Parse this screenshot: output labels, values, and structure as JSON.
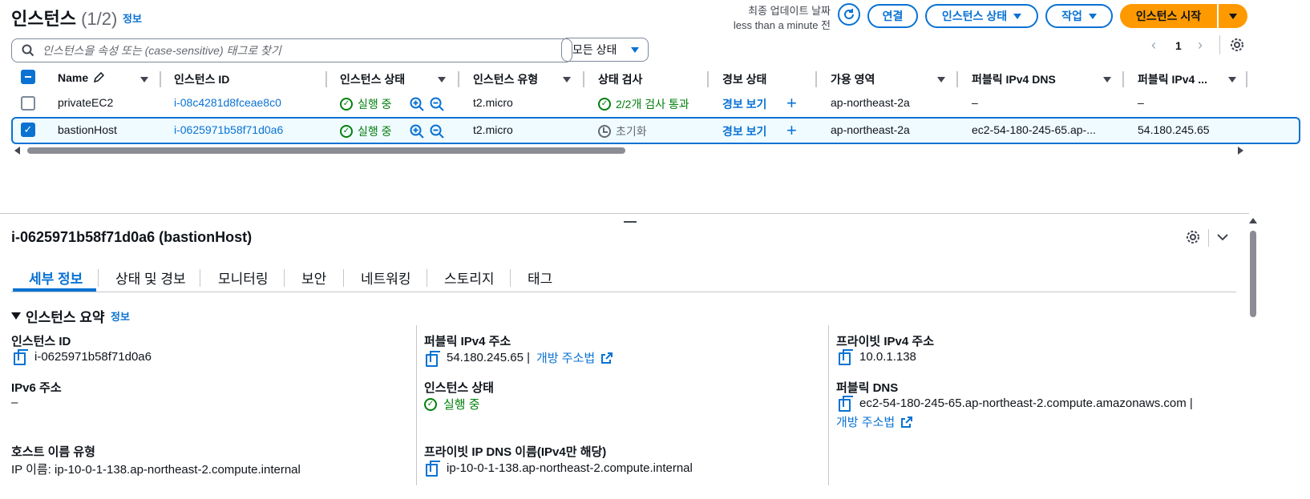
{
  "header": {
    "title": "인스턴스",
    "count": "(1/2)",
    "info_link": "정보",
    "last_updated_label": "최종 업데이트 날짜",
    "last_updated_value": "less than a minute 전",
    "connect_button": "연결",
    "instance_state_button": "인스턴스 상태",
    "actions_button": "작업",
    "launch_button": "인스턴스 시작"
  },
  "filter": {
    "search_placeholder": "인스턴스을 속성 또는 (case-sensitive) 태그로 찾기",
    "state_select": "모든 상태",
    "page": "1"
  },
  "table": {
    "columns": [
      "Name",
      "인스턴스 ID",
      "인스턴스 상태",
      "인스턴스 유형",
      "상태 검사",
      "경보 상태",
      "가용 영역",
      "퍼블릭 IPv4 DNS",
      "퍼블릭 IPv4 ..."
    ],
    "rows": [
      {
        "name": "privateEC2",
        "id": "i-08c4281d8fceae8c0",
        "state": "실행 중",
        "type": "t2.micro",
        "check": "2/2개 검사 통과",
        "alarm": "경보 보기",
        "az": "ap-northeast-2a",
        "dns": "–",
        "ip": "–",
        "selected": false
      },
      {
        "name": "bastionHost",
        "id": "i-0625971b58f71d0a6",
        "state": "실행 중",
        "type": "t2.micro",
        "check": "초기화",
        "alarm": "경보 보기",
        "az": "ap-northeast-2a",
        "dns": "ec2-54-180-245-65.ap-...",
        "ip": "54.180.245.65",
        "selected": true
      }
    ]
  },
  "detail": {
    "title": "i-0625971b58f71d0a6 (bastionHost)",
    "tabs": [
      "세부 정보",
      "상태 및 경보",
      "모니터링",
      "보안",
      "네트워킹",
      "스토리지",
      "태그"
    ],
    "section_title": "인스턴스 요약",
    "section_info": "정보",
    "fields": {
      "instance_id_label": "인스턴스 ID",
      "instance_id": "i-0625971b58f71d0a6",
      "ipv6_label": "IPv6 주소",
      "ipv6": "–",
      "hostname_type_label": "호스트 이름 유형",
      "hostname_type": "IP 이름: ip-10-0-1-138.ap-northeast-2.compute.internal",
      "public_ipv4_label": "퍼블릭 IPv4 주소",
      "public_ipv4": "54.180.245.65 |",
      "open_address": "개방 주소법",
      "instance_state_label": "인스턴스 상태",
      "instance_state": "실행 중",
      "private_dns_label": "프라이빗 IP DNS 이름(IPv4만 해당)",
      "private_dns": "ip-10-0-1-138.ap-northeast-2.compute.internal",
      "private_ipv4_label": "프라이빗 IPv4 주소",
      "private_ipv4": "10.0.1.138",
      "public_dns_label": "퍼블릭 DNS",
      "public_dns": "ec2-54-180-245-65.ap-northeast-2.compute.amazonaws.com |",
      "open_address_2": "개방 주소법"
    }
  }
}
